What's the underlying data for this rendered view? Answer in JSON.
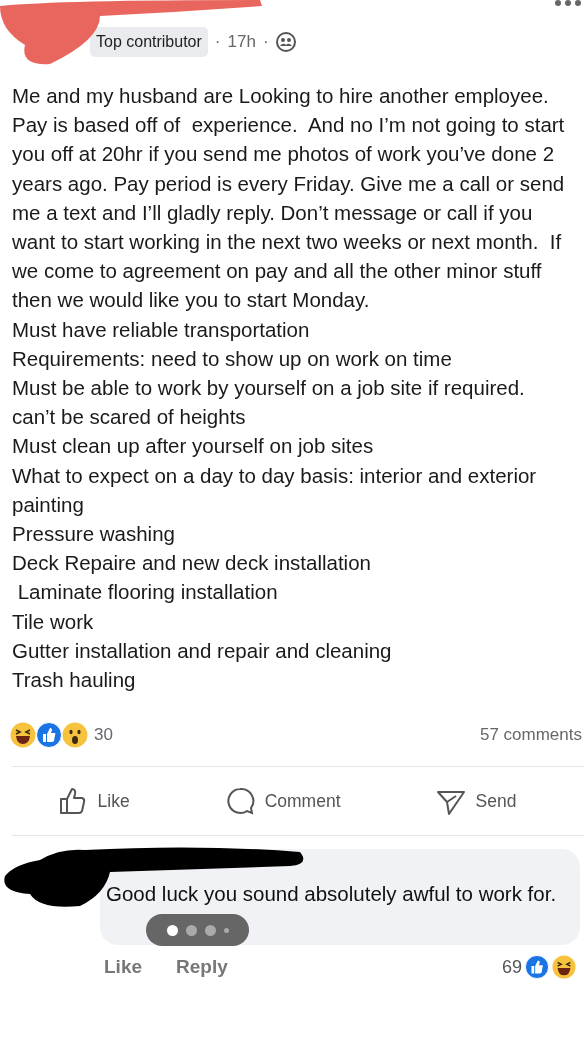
{
  "post": {
    "badge": "Top contributor",
    "separator_1": "·",
    "time": "17h",
    "separator_2": "·",
    "paragraphs": [
      "Me and my husband are Looking to hire another employee. Pay is based off of  experience.  And no I’m not going to start you off at 20hr if you send me photos of work you’ve done 2 years ago. Pay period is every Friday. Give me a call or send me a text and I’ll gladly reply. Don’t message or call if you want to start working in the next two weeks or next month.  If we come to agreement on pay and all the other minor stuff then we would like you to start Monday.",
      "Must have reliable transportation",
      "Requirements: need to show up on work on time",
      "Must be able to work by yourself on a job site if required.",
      "can’t be scared of heights",
      "Must clean up after yourself on job sites",
      "What to expect on a day to day basis: interior and exterior painting",
      "Pressure washing",
      "Deck Repaire and new deck installation",
      " Laminate flooring installation",
      "Tile work",
      "Gutter installation and repair and cleaning",
      "Trash hauling"
    ],
    "reaction_count": "30",
    "comment_count": "57 comments"
  },
  "actions": [
    {
      "kind": "like",
      "label": "Like"
    },
    {
      "kind": "comment",
      "label": "Comment"
    },
    {
      "kind": "send",
      "label": "Send"
    }
  ],
  "comment": {
    "text": "Good luck you sound absolutely awful to work for.",
    "page_dots": [
      {
        "selected": true
      },
      {
        "selected": false
      },
      {
        "selected": false
      },
      {
        "selected": false
      }
    ],
    "links": [
      "Like",
      "Reply"
    ],
    "reaction_count": "69"
  }
}
